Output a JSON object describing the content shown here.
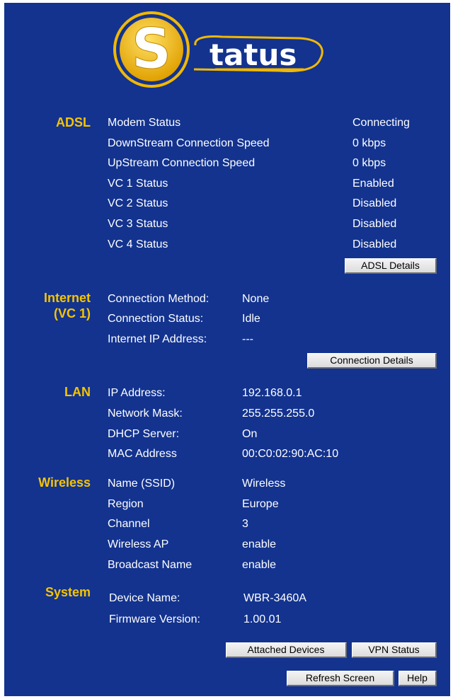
{
  "logo": {
    "text": "tatus",
    "letter": "S"
  },
  "adsl": {
    "section": "ADSL",
    "rows": [
      {
        "label": "Modem Status",
        "value": "Connecting"
      },
      {
        "label": "DownStream Connection Speed",
        "value": "0 kbps"
      },
      {
        "label": "UpStream Connection Speed",
        "value": "0 kbps"
      },
      {
        "label": "VC 1 Status",
        "value": "Enabled"
      },
      {
        "label": "VC 2 Status",
        "value": "Disabled"
      },
      {
        "label": "VC 3 Status",
        "value": "Disabled"
      },
      {
        "label": "VC 4 Status",
        "value": "Disabled"
      }
    ],
    "details_button": "ADSL Details"
  },
  "internet": {
    "section_line1": "Internet",
    "section_line2": "(VC 1)",
    "rows": [
      {
        "label": "Connection Method:",
        "value": "None"
      },
      {
        "label": "Connection Status:",
        "value": "Idle"
      },
      {
        "label": "Internet IP Address:",
        "value": "---"
      }
    ],
    "details_button": "Connection Details"
  },
  "lan": {
    "section": "LAN",
    "rows": [
      {
        "label": "IP Address:",
        "value": "192.168.0.1"
      },
      {
        "label": "Network Mask:",
        "value": "255.255.255.0"
      },
      {
        "label": "DHCP Server:",
        "value": "On"
      },
      {
        "label": "MAC Address",
        "value": "00:C0:02:90:AC:10"
      }
    ]
  },
  "wireless": {
    "section": "Wireless",
    "rows": [
      {
        "label": "Name (SSID)",
        "value": "Wireless"
      },
      {
        "label": "Region",
        "value": "Europe"
      },
      {
        "label": "Channel",
        "value": "3"
      },
      {
        "label": "Wireless AP",
        "value": "enable"
      },
      {
        "label": "Broadcast Name",
        "value": "enable"
      }
    ]
  },
  "system": {
    "section": "System",
    "rows": [
      {
        "label": "Device Name:",
        "value": "WBR-3460A"
      },
      {
        "label": "Firmware Version:",
        "value": "1.00.01"
      }
    ]
  },
  "buttons": {
    "attached_devices": "Attached Devices",
    "vpn_status": "VPN Status",
    "refresh_screen": "Refresh Screen",
    "help": "Help"
  },
  "colors": {
    "background": "#13338f",
    "section_heading": "#f6c400",
    "text": "#ffffff",
    "logo_gold": "#f2b800"
  }
}
